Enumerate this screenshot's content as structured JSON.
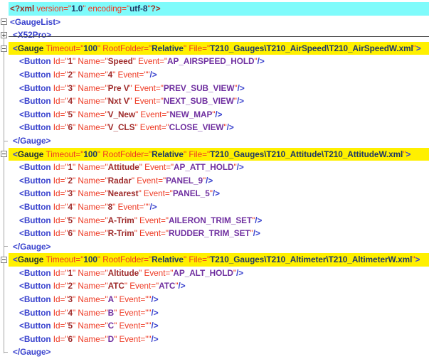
{
  "app": {
    "description": "XML tree editor showing X52Pro gauge configuration"
  },
  "colors": {
    "declaration_row_bg": "#7FFBFB",
    "gauge_row_bg": "#FFF000",
    "selection_underline": "#3B3B3B",
    "tree_line": "#A6A6A6",
    "tag_blue": "#3A43CE",
    "gauge_tag_dark": "#1C2B39",
    "pi_maroon": "#9B3328",
    "attr_red": "#EE3A24",
    "value_maroon": "#9E2B2B",
    "value_purple": "#7030A0",
    "value_navy": "#1F3864"
  },
  "token_styles": {
    "t": {
      "name": "xml-tag",
      "color": "#3A43CE",
      "weight": "600"
    },
    "tg": {
      "name": "gauge-tag-name",
      "color": "#1C2B39",
      "weight": "600"
    },
    "pi": {
      "name": "xml-declaration-delimiter",
      "color": "#9B3328",
      "weight": "600"
    },
    "a": {
      "name": "attribute-name",
      "color": "#EE3A24",
      "weight": "400"
    },
    "vm": {
      "name": "attribute-value",
      "color": "#9E2B2B",
      "weight": "700"
    },
    "vp": {
      "name": "event-value",
      "color": "#7030A0",
      "weight": "700"
    },
    "vn": {
      "name": "path-value",
      "color": "#1F3864",
      "weight": "700"
    }
  },
  "editor": {
    "rows": [
      {
        "name": "xml-declaration-line",
        "bg": "cyan",
        "indent": 0,
        "gutter": null,
        "tokens": [
          [
            "pi",
            "<?xml "
          ],
          [
            "a",
            "version=\""
          ],
          [
            "vn",
            "1.0"
          ],
          [
            "a",
            "\" encoding=\""
          ],
          [
            "vn",
            "utf-8"
          ],
          [
            "a",
            "\""
          ],
          [
            "pi",
            "?>"
          ]
        ]
      },
      {
        "name": "gaugelist-open-tag-line",
        "bg": null,
        "indent": 0,
        "gutter": "minus",
        "tokens": [
          [
            "t",
            "<GaugeList>"
          ]
        ]
      },
      {
        "name": "x52pro-open-tag-line",
        "bg": null,
        "indent": 1,
        "gutter": "plus",
        "tokens": [
          [
            "t",
            "<X52Pro>"
          ]
        ]
      },
      {
        "name": "gauge-airspeed-open-tag-line",
        "bg": "yellow",
        "indent": 1,
        "gutter": "minus",
        "tokens": [
          [
            "t",
            "<"
          ],
          [
            "tg",
            "Gauge "
          ],
          [
            "a",
            "Timeout=\""
          ],
          [
            "vn",
            "100"
          ],
          [
            "a",
            "\" RootFolder=\""
          ],
          [
            "vn",
            "Relative"
          ],
          [
            "a",
            "\" File=\""
          ],
          [
            "vn",
            "T210_Gauges\\T210_AirSpeed\\T210_AirSpeedW.xml"
          ],
          [
            "a",
            "\""
          ],
          [
            "t",
            ">"
          ]
        ]
      },
      {
        "name": "button-speed-line",
        "bg": null,
        "indent": 2,
        "gutter": null,
        "tokens": [
          [
            "t",
            "<Button "
          ],
          [
            "a",
            "Id=\""
          ],
          [
            "vm",
            "1"
          ],
          [
            "a",
            "\" Name=\""
          ],
          [
            "vm",
            "Speed"
          ],
          [
            "a",
            "\" Event=\""
          ],
          [
            "vp",
            "AP_AIRSPEED_HOLD"
          ],
          [
            "a",
            "\""
          ],
          [
            "t",
            "/>"
          ]
        ]
      },
      {
        "name": "button-4-line",
        "bg": null,
        "indent": 2,
        "gutter": null,
        "tokens": [
          [
            "t",
            "<Button "
          ],
          [
            "a",
            "Id=\""
          ],
          [
            "vm",
            "2"
          ],
          [
            "a",
            "\" Name=\""
          ],
          [
            "vm",
            "4"
          ],
          [
            "a",
            "\" Event=\"\""
          ],
          [
            "t",
            "/>"
          ]
        ]
      },
      {
        "name": "button-prev-view-line",
        "bg": null,
        "indent": 2,
        "gutter": null,
        "tokens": [
          [
            "t",
            "<Button "
          ],
          [
            "a",
            "Id=\""
          ],
          [
            "vm",
            "3"
          ],
          [
            "a",
            "\" Name=\""
          ],
          [
            "vm",
            "Pre V"
          ],
          [
            "a",
            "\" Event=\""
          ],
          [
            "vp",
            "PREV_SUB_VIEW"
          ],
          [
            "a",
            "\""
          ],
          [
            "t",
            "/>"
          ]
        ]
      },
      {
        "name": "button-next-view-line",
        "bg": null,
        "indent": 2,
        "gutter": null,
        "tokens": [
          [
            "t",
            "<Button "
          ],
          [
            "a",
            "Id=\""
          ],
          [
            "vm",
            "4"
          ],
          [
            "a",
            "\" Name=\""
          ],
          [
            "vm",
            "Nxt V"
          ],
          [
            "a",
            "\" Event=\""
          ],
          [
            "vp",
            "NEXT_SUB_VIEW"
          ],
          [
            "a",
            "\""
          ],
          [
            "t",
            "/>"
          ]
        ]
      },
      {
        "name": "button-new-map-line",
        "bg": null,
        "indent": 2,
        "gutter": null,
        "tokens": [
          [
            "t",
            "<Button "
          ],
          [
            "a",
            "Id=\""
          ],
          [
            "vm",
            "5"
          ],
          [
            "a",
            "\" Name=\""
          ],
          [
            "vm",
            "V_New"
          ],
          [
            "a",
            "\" Event=\""
          ],
          [
            "vp",
            "NEW_MAP"
          ],
          [
            "a",
            "\""
          ],
          [
            "t",
            "/>"
          ]
        ]
      },
      {
        "name": "button-close-view-line",
        "bg": null,
        "indent": 2,
        "gutter": null,
        "tokens": [
          [
            "t",
            "<Button "
          ],
          [
            "a",
            "Id=\""
          ],
          [
            "vm",
            "6"
          ],
          [
            "a",
            "\" Name=\""
          ],
          [
            "vm",
            "V_CLS"
          ],
          [
            "a",
            "\" Event=\""
          ],
          [
            "vp",
            "CLOSE_VIEW"
          ],
          [
            "a",
            "\""
          ],
          [
            "t",
            "/>"
          ]
        ]
      },
      {
        "name": "gauge-close-tag-line",
        "bg": null,
        "indent": 1,
        "gutter": "corner",
        "tokens": [
          [
            "t",
            "</Gauge>"
          ]
        ]
      },
      {
        "name": "gauge-attitude-open-tag-line",
        "bg": "yellow",
        "indent": 1,
        "gutter": "minus",
        "tokens": [
          [
            "t",
            "<"
          ],
          [
            "tg",
            "Gauge "
          ],
          [
            "a",
            "Timeout=\""
          ],
          [
            "vn",
            "100"
          ],
          [
            "a",
            "\" RootFolder=\""
          ],
          [
            "vn",
            "Relative"
          ],
          [
            "a",
            "\" File=\""
          ],
          [
            "vn",
            "T210_Gauges\\T210_Attitude\\T210_AttitudeW.xml"
          ],
          [
            "a",
            "\""
          ],
          [
            "t",
            ">"
          ]
        ]
      },
      {
        "name": "button-attitude-line",
        "bg": null,
        "indent": 2,
        "gutter": null,
        "tokens": [
          [
            "t",
            "<Button "
          ],
          [
            "a",
            "Id=\""
          ],
          [
            "vm",
            "1"
          ],
          [
            "a",
            "\" Name=\""
          ],
          [
            "vm",
            "Attitude"
          ],
          [
            "a",
            "\" Event=\""
          ],
          [
            "vp",
            "AP_ATT_HOLD"
          ],
          [
            "a",
            "\""
          ],
          [
            "t",
            "/>"
          ]
        ]
      },
      {
        "name": "button-radar-line",
        "bg": null,
        "indent": 2,
        "gutter": null,
        "tokens": [
          [
            "t",
            "<Button "
          ],
          [
            "a",
            "Id=\""
          ],
          [
            "vm",
            "2"
          ],
          [
            "a",
            "\" Name=\""
          ],
          [
            "vm",
            "Radar"
          ],
          [
            "a",
            "\" Event=\""
          ],
          [
            "vp",
            "PANEL_9"
          ],
          [
            "a",
            "\""
          ],
          [
            "t",
            "/>"
          ]
        ]
      },
      {
        "name": "button-nearest-line",
        "bg": null,
        "indent": 2,
        "gutter": null,
        "tokens": [
          [
            "t",
            "<Button "
          ],
          [
            "a",
            "Id=\""
          ],
          [
            "vm",
            "3"
          ],
          [
            "a",
            "\" Name=\""
          ],
          [
            "vm",
            "Nearest"
          ],
          [
            "a",
            "\" Event=\""
          ],
          [
            "vp",
            "PANEL_5"
          ],
          [
            "a",
            "\""
          ],
          [
            "t",
            "/>"
          ]
        ]
      },
      {
        "name": "button-8-line",
        "bg": null,
        "indent": 2,
        "gutter": null,
        "tokens": [
          [
            "t",
            "<Button "
          ],
          [
            "a",
            "Id=\""
          ],
          [
            "vm",
            "4"
          ],
          [
            "a",
            "\" Name=\""
          ],
          [
            "vm",
            "8"
          ],
          [
            "a",
            "\" Event=\"\""
          ],
          [
            "t",
            "/>"
          ]
        ]
      },
      {
        "name": "button-aileron-trim-line",
        "bg": null,
        "indent": 2,
        "gutter": null,
        "tokens": [
          [
            "t",
            "<Button "
          ],
          [
            "a",
            "Id=\""
          ],
          [
            "vm",
            "5"
          ],
          [
            "a",
            "\" Name=\""
          ],
          [
            "vm",
            "A-Trim"
          ],
          [
            "a",
            "\" Event=\""
          ],
          [
            "vp",
            "AILERON_TRIM_SET"
          ],
          [
            "a",
            "\""
          ],
          [
            "t",
            "/>"
          ]
        ]
      },
      {
        "name": "button-rudder-trim-line",
        "bg": null,
        "indent": 2,
        "gutter": null,
        "tokens": [
          [
            "t",
            "<Button "
          ],
          [
            "a",
            "Id=\""
          ],
          [
            "vm",
            "6"
          ],
          [
            "a",
            "\" Name=\""
          ],
          [
            "vm",
            "R-Trim"
          ],
          [
            "a",
            "\" Event=\""
          ],
          [
            "vp",
            "RUDDER_TRIM_SET"
          ],
          [
            "a",
            "\""
          ],
          [
            "t",
            "/>"
          ]
        ]
      },
      {
        "name": "gauge-close-tag-line",
        "bg": null,
        "indent": 1,
        "gutter": "corner",
        "tokens": [
          [
            "t",
            "</Gauge>"
          ]
        ]
      },
      {
        "name": "gauge-altimeter-open-tag-line",
        "bg": "yellow",
        "indent": 1,
        "gutter": "minus",
        "tokens": [
          [
            "t",
            "<"
          ],
          [
            "tg",
            "Gauge "
          ],
          [
            "a",
            "Timeout=\""
          ],
          [
            "vn",
            "100"
          ],
          [
            "a",
            "\" RootFolder=\""
          ],
          [
            "vn",
            "Relative"
          ],
          [
            "a",
            "\" File=\""
          ],
          [
            "vn",
            "T210_Gauges\\T210_Altimeter\\T210_AltimeterW.xml"
          ],
          [
            "a",
            "\""
          ],
          [
            "t",
            ">"
          ]
        ]
      },
      {
        "name": "button-altitude-line",
        "bg": null,
        "indent": 2,
        "gutter": null,
        "tokens": [
          [
            "t",
            "<Button "
          ],
          [
            "a",
            "Id=\""
          ],
          [
            "vm",
            "1"
          ],
          [
            "a",
            "\" Name=\""
          ],
          [
            "vm",
            "Altitude"
          ],
          [
            "a",
            "\" Event=\""
          ],
          [
            "vp",
            "AP_ALT_HOLD"
          ],
          [
            "a",
            "\""
          ],
          [
            "t",
            "/>"
          ]
        ]
      },
      {
        "name": "button-atc-line",
        "bg": null,
        "indent": 2,
        "gutter": null,
        "tokens": [
          [
            "t",
            "<Button "
          ],
          [
            "a",
            "Id=\""
          ],
          [
            "vm",
            "2"
          ],
          [
            "a",
            "\" Name=\""
          ],
          [
            "vm",
            "ATC"
          ],
          [
            "a",
            "\" Event=\""
          ],
          [
            "vp",
            "ATC"
          ],
          [
            "a",
            "\""
          ],
          [
            "t",
            "/>"
          ]
        ]
      },
      {
        "name": "button-a-line",
        "bg": null,
        "indent": 2,
        "gutter": null,
        "tokens": [
          [
            "t",
            "<Button "
          ],
          [
            "a",
            "Id=\""
          ],
          [
            "vm",
            "3"
          ],
          [
            "a",
            "\" Name=\""
          ],
          [
            "vp",
            "A"
          ],
          [
            "a",
            "\" Event=\"\""
          ],
          [
            "t",
            "/>"
          ]
        ]
      },
      {
        "name": "button-b-line",
        "bg": null,
        "indent": 2,
        "gutter": null,
        "tokens": [
          [
            "t",
            "<Button "
          ],
          [
            "a",
            "Id=\""
          ],
          [
            "vm",
            "4"
          ],
          [
            "a",
            "\" Name=\""
          ],
          [
            "vp",
            "B"
          ],
          [
            "a",
            "\" Event=\"\""
          ],
          [
            "t",
            "/>"
          ]
        ]
      },
      {
        "name": "button-c-line",
        "bg": null,
        "indent": 2,
        "gutter": null,
        "tokens": [
          [
            "t",
            "<Button "
          ],
          [
            "a",
            "Id=\""
          ],
          [
            "vm",
            "5"
          ],
          [
            "a",
            "\" Name=\""
          ],
          [
            "vp",
            "C"
          ],
          [
            "a",
            "\" Event=\"\""
          ],
          [
            "t",
            "/>"
          ]
        ]
      },
      {
        "name": "button-d-line",
        "bg": null,
        "indent": 2,
        "gutter": null,
        "tokens": [
          [
            "t",
            "<Button "
          ],
          [
            "a",
            "Id=\""
          ],
          [
            "vm",
            "6"
          ],
          [
            "a",
            "\" Name=\""
          ],
          [
            "vp",
            "D"
          ],
          [
            "a",
            "\" Event=\"\""
          ],
          [
            "t",
            "/>"
          ]
        ]
      },
      {
        "name": "gauge-close-tag-line",
        "bg": null,
        "indent": 1,
        "gutter": "corner",
        "tokens": [
          [
            "t",
            "</Gauge>"
          ]
        ]
      }
    ]
  }
}
